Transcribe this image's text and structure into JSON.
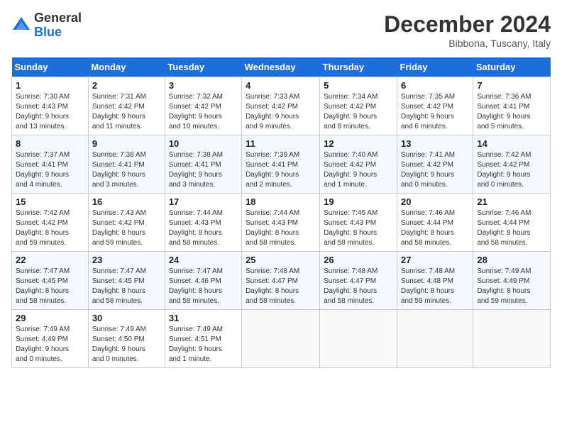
{
  "header": {
    "logo_general": "General",
    "logo_blue": "Blue",
    "month_title": "December 2024",
    "location": "Bibbona, Tuscany, Italy"
  },
  "columns": [
    "Sunday",
    "Monday",
    "Tuesday",
    "Wednesday",
    "Thursday",
    "Friday",
    "Saturday"
  ],
  "weeks": [
    [
      {
        "day": "1",
        "info": "Sunrise: 7:30 AM\nSunset: 4:43 PM\nDaylight: 9 hours\nand 13 minutes."
      },
      {
        "day": "2",
        "info": "Sunrise: 7:31 AM\nSunset: 4:42 PM\nDaylight: 9 hours\nand 11 minutes."
      },
      {
        "day": "3",
        "info": "Sunrise: 7:32 AM\nSunset: 4:42 PM\nDaylight: 9 hours\nand 10 minutes."
      },
      {
        "day": "4",
        "info": "Sunrise: 7:33 AM\nSunset: 4:42 PM\nDaylight: 9 hours\nand 9 minutes."
      },
      {
        "day": "5",
        "info": "Sunrise: 7:34 AM\nSunset: 4:42 PM\nDaylight: 9 hours\nand 8 minutes."
      },
      {
        "day": "6",
        "info": "Sunrise: 7:35 AM\nSunset: 4:42 PM\nDaylight: 9 hours\nand 6 minutes."
      },
      {
        "day": "7",
        "info": "Sunrise: 7:36 AM\nSunset: 4:41 PM\nDaylight: 9 hours\nand 5 minutes."
      }
    ],
    [
      {
        "day": "8",
        "info": "Sunrise: 7:37 AM\nSunset: 4:41 PM\nDaylight: 9 hours\nand 4 minutes."
      },
      {
        "day": "9",
        "info": "Sunrise: 7:38 AM\nSunset: 4:41 PM\nDaylight: 9 hours\nand 3 minutes."
      },
      {
        "day": "10",
        "info": "Sunrise: 7:38 AM\nSunset: 4:41 PM\nDaylight: 9 hours\nand 3 minutes."
      },
      {
        "day": "11",
        "info": "Sunrise: 7:39 AM\nSunset: 4:41 PM\nDaylight: 9 hours\nand 2 minutes."
      },
      {
        "day": "12",
        "info": "Sunrise: 7:40 AM\nSunset: 4:42 PM\nDaylight: 9 hours\nand 1 minute."
      },
      {
        "day": "13",
        "info": "Sunrise: 7:41 AM\nSunset: 4:42 PM\nDaylight: 9 hours\nand 0 minutes."
      },
      {
        "day": "14",
        "info": "Sunrise: 7:42 AM\nSunset: 4:42 PM\nDaylight: 9 hours\nand 0 minutes."
      }
    ],
    [
      {
        "day": "15",
        "info": "Sunrise: 7:42 AM\nSunset: 4:42 PM\nDaylight: 8 hours\nand 59 minutes."
      },
      {
        "day": "16",
        "info": "Sunrise: 7:43 AM\nSunset: 4:42 PM\nDaylight: 8 hours\nand 59 minutes."
      },
      {
        "day": "17",
        "info": "Sunrise: 7:44 AM\nSunset: 4:43 PM\nDaylight: 8 hours\nand 58 minutes."
      },
      {
        "day": "18",
        "info": "Sunrise: 7:44 AM\nSunset: 4:43 PM\nDaylight: 8 hours\nand 58 minutes."
      },
      {
        "day": "19",
        "info": "Sunrise: 7:45 AM\nSunset: 4:43 PM\nDaylight: 8 hours\nand 58 minutes."
      },
      {
        "day": "20",
        "info": "Sunrise: 7:46 AM\nSunset: 4:44 PM\nDaylight: 8 hours\nand 58 minutes."
      },
      {
        "day": "21",
        "info": "Sunrise: 7:46 AM\nSunset: 4:44 PM\nDaylight: 8 hours\nand 58 minutes."
      }
    ],
    [
      {
        "day": "22",
        "info": "Sunrise: 7:47 AM\nSunset: 4:45 PM\nDaylight: 8 hours\nand 58 minutes."
      },
      {
        "day": "23",
        "info": "Sunrise: 7:47 AM\nSunset: 4:45 PM\nDaylight: 8 hours\nand 58 minutes."
      },
      {
        "day": "24",
        "info": "Sunrise: 7:47 AM\nSunset: 4:46 PM\nDaylight: 8 hours\nand 58 minutes."
      },
      {
        "day": "25",
        "info": "Sunrise: 7:48 AM\nSunset: 4:47 PM\nDaylight: 8 hours\nand 58 minutes."
      },
      {
        "day": "26",
        "info": "Sunrise: 7:48 AM\nSunset: 4:47 PM\nDaylight: 8 hours\nand 58 minutes."
      },
      {
        "day": "27",
        "info": "Sunrise: 7:48 AM\nSunset: 4:48 PM\nDaylight: 8 hours\nand 59 minutes."
      },
      {
        "day": "28",
        "info": "Sunrise: 7:49 AM\nSunset: 4:49 PM\nDaylight: 8 hours\nand 59 minutes."
      }
    ],
    [
      {
        "day": "29",
        "info": "Sunrise: 7:49 AM\nSunset: 4:49 PM\nDaylight: 9 hours\nand 0 minutes."
      },
      {
        "day": "30",
        "info": "Sunrise: 7:49 AM\nSunset: 4:50 PM\nDaylight: 9 hours\nand 0 minutes."
      },
      {
        "day": "31",
        "info": "Sunrise: 7:49 AM\nSunset: 4:51 PM\nDaylight: 9 hours\nand 1 minute."
      },
      null,
      null,
      null,
      null
    ]
  ]
}
